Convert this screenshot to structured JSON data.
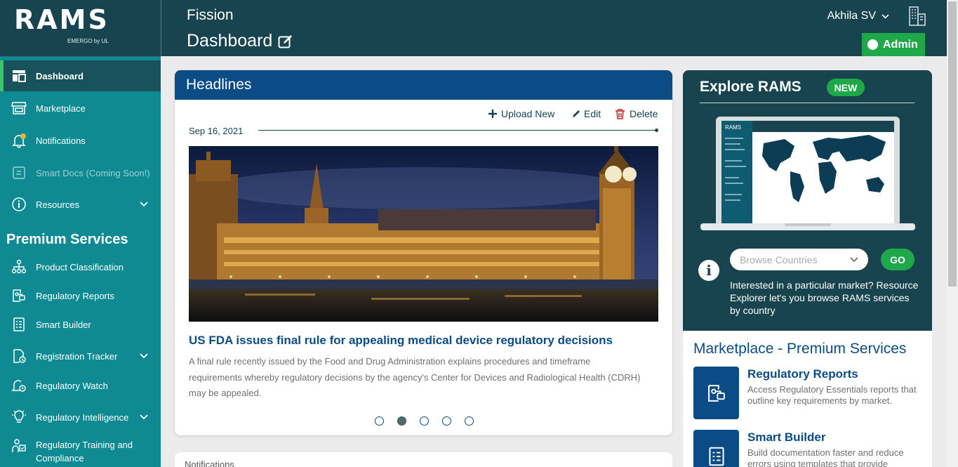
{
  "brand": {
    "logo_text": "RAMS",
    "logo_sub": "EMERGO by UL"
  },
  "header": {
    "app_title": "Fission",
    "page_title": "Dashboard",
    "user_name": "Akhila SV",
    "role_badge": "Admin"
  },
  "sidebar": {
    "items": [
      {
        "label": "Dashboard",
        "icon": "dashboard-icon",
        "active": true
      },
      {
        "label": "Marketplace",
        "icon": "store-icon"
      },
      {
        "label": "Notifications",
        "icon": "bell-icon"
      },
      {
        "label": "Smart Docs (Coming Soon!)",
        "icon": "smart-docs-icon",
        "disabled": true
      },
      {
        "label": "Resources",
        "icon": "info-icon",
        "expandable": true
      }
    ],
    "premium_title": "Premium Services",
    "premium_items": [
      {
        "label": "Product Classification",
        "icon": "hierarchy-icon"
      },
      {
        "label": "Regulatory Reports",
        "icon": "report-icon"
      },
      {
        "label": "Smart Builder",
        "icon": "builder-icon"
      },
      {
        "label": "Registration Tracker",
        "icon": "tracker-icon",
        "expandable": true
      },
      {
        "label": "Regulatory Watch",
        "icon": "watch-bell-icon"
      },
      {
        "label": "Regulatory Intelligence",
        "icon": "lightbulb-icon",
        "expandable": true
      },
      {
        "label": "Regulatory Training and Compliance",
        "icon": "training-icon"
      }
    ]
  },
  "headlines": {
    "title": "Headlines",
    "actions": {
      "upload": "Upload New",
      "edit": "Edit",
      "delete": "Delete"
    },
    "date": "Sep 16, 2021",
    "article_title": "US FDA issues final rule for appealing medical device regulatory decisions",
    "article_summary": "A final rule recently issued by the Food and Drug Administration explains procedures and timeframe requirements whereby regulatory decisions by the agency's Center for Devices and Radiological Health (CDRH) may be appealed.",
    "carousel": {
      "total": 5,
      "active_index": 1
    }
  },
  "notifications_card": {
    "title": "Notifications"
  },
  "explore": {
    "title": "Explore RAMS",
    "badge": "NEW",
    "select_placeholder": "Browse Countries",
    "go_label": "GO",
    "description": "Interested in a particular market? Resource Explorer let's you browse RAMS services by country"
  },
  "marketplace": {
    "title": "Marketplace - Premium Services",
    "items": [
      {
        "name": "Regulatory Reports",
        "desc": "Access Regulatory Essentials reports that outline key requirements by market.",
        "icon": "report-icon"
      },
      {
        "name": "Smart Builder",
        "desc": "Build documentation faster and reduce errors using templates that provide",
        "icon": "builder-icon"
      }
    ]
  },
  "colors": {
    "sidebar": "#0f8a92",
    "header": "#17444f",
    "primary": "#0b4b86",
    "accent": "#1fa84a"
  }
}
